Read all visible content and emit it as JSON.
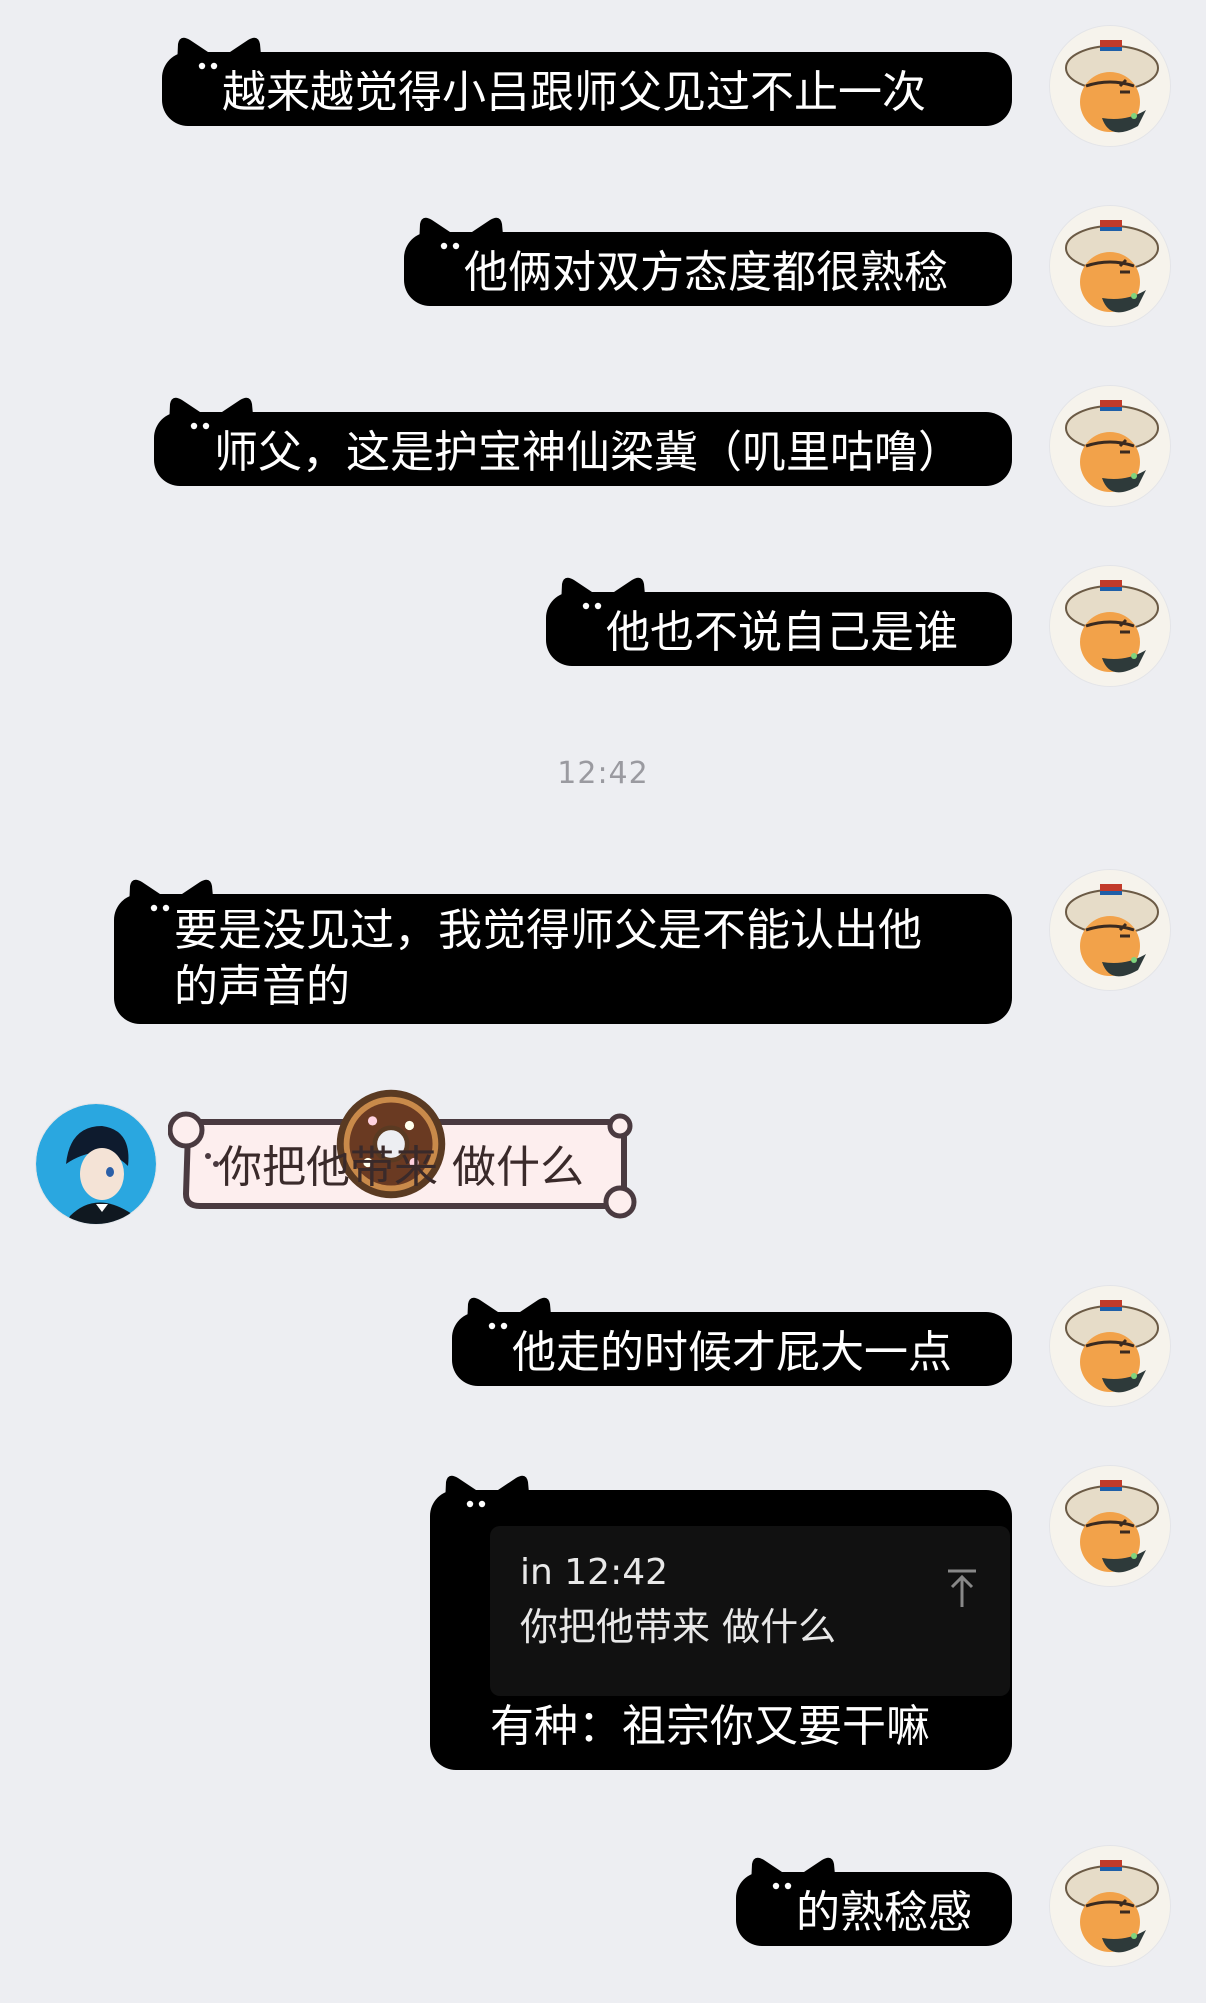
{
  "chat": {
    "messages": [
      {
        "text": "越来越觉得小吕跟师父见过不止一次"
      },
      {
        "text": "他俩对双方态度都很熟稔"
      },
      {
        "text": "师父，这是护宝神仙梁冀（叽里咕噜）"
      },
      {
        "text": "他也不说自己是谁"
      },
      {
        "line1": "要是没见过，我觉得师父是不能认出他",
        "line2": "的声音的"
      },
      {
        "text": "你把他带来 做什么"
      },
      {
        "text": "他走的时候才屁大一点"
      },
      {
        "quote_meta": "in 12:42",
        "quote_text": "你把他带来 做什么",
        "text": "有种：祖宗你又要干嘛"
      },
      {
        "text": "的熟稔感"
      }
    ],
    "timestamp": "12:42"
  },
  "icons": {
    "sender_avatar": "cartoon-avatar",
    "contact_avatar": "anime-boy-avatar",
    "bubble_decoration": "cat-ears",
    "donut": "donut-icon",
    "quote_jump": "arrow-up-icon"
  },
  "colors": {
    "background": "#edeef2",
    "sent_bubble": "#000000",
    "received_bubble": "#fdeeee",
    "received_border": "#4a3a40",
    "timestamp": "#9a9aa0"
  }
}
